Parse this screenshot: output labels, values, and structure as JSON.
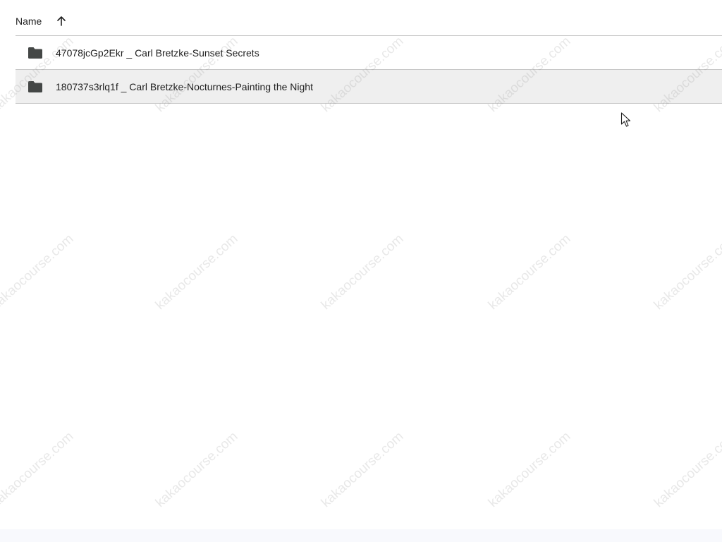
{
  "header": {
    "name_label": "Name",
    "sort_icon": "arrow-up-icon"
  },
  "items": [
    {
      "icon": "folder-icon",
      "label": "47078jcGp2Ekr _ Carl Bretzke-Sunset Secrets"
    },
    {
      "icon": "folder-icon",
      "label": "180737s3rlq1f _ Carl Bretzke-Nocturnes-Painting the Night"
    }
  ],
  "watermark": {
    "text": "kakaocourse.com"
  },
  "colors": {
    "row_hover": "#efefef",
    "divider": "#c7c7c7",
    "icon": "#444746",
    "text": "#1f1f1f"
  }
}
